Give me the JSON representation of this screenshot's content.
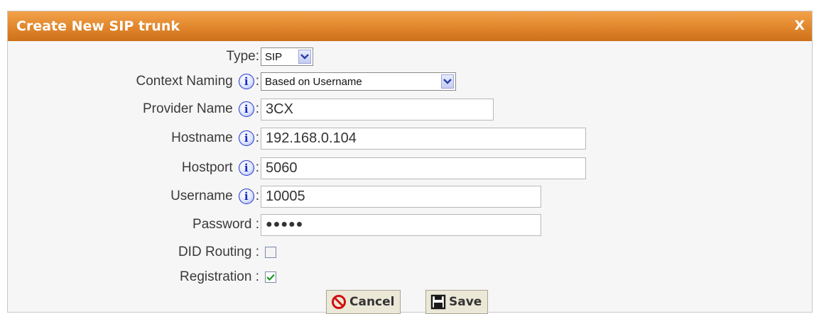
{
  "dialog": {
    "title": "Create New SIP trunk",
    "close_label": "X"
  },
  "info_glyph": "i",
  "form": {
    "type": {
      "label": "Type:",
      "value": "SIP"
    },
    "context_naming": {
      "label": "Context Naming",
      "suffix": ":",
      "value": "Based on Username"
    },
    "provider_name": {
      "label": "Provider Name",
      "suffix": ":",
      "value": "3CX"
    },
    "hostname": {
      "label": "Hostname",
      "suffix": ":",
      "value": "192.168.0.104"
    },
    "hostport": {
      "label": "Hostport",
      "suffix": ":",
      "value": "5060"
    },
    "username": {
      "label": "Username",
      "suffix": ":",
      "value": "10005"
    },
    "password": {
      "label": "Password :",
      "value": "●●●●●"
    },
    "did_routing": {
      "label": "DID Routing :",
      "checked": false
    },
    "registration": {
      "label": "Registration :",
      "checked": true
    }
  },
  "buttons": {
    "cancel": "Cancel",
    "save": "Save"
  },
  "icons": {
    "info": "info-icon",
    "cancel": "no-entry-icon",
    "save": "floppy-disk-icon",
    "dropdown": "chevron-down-icon",
    "check": "checkmark-icon"
  },
  "colors": {
    "titlebar": "#e08a2c",
    "title_text": "#ffffff",
    "info_icon": "#1428c8",
    "cancel_icon": "#d01010",
    "check": "#1a9a1a"
  }
}
